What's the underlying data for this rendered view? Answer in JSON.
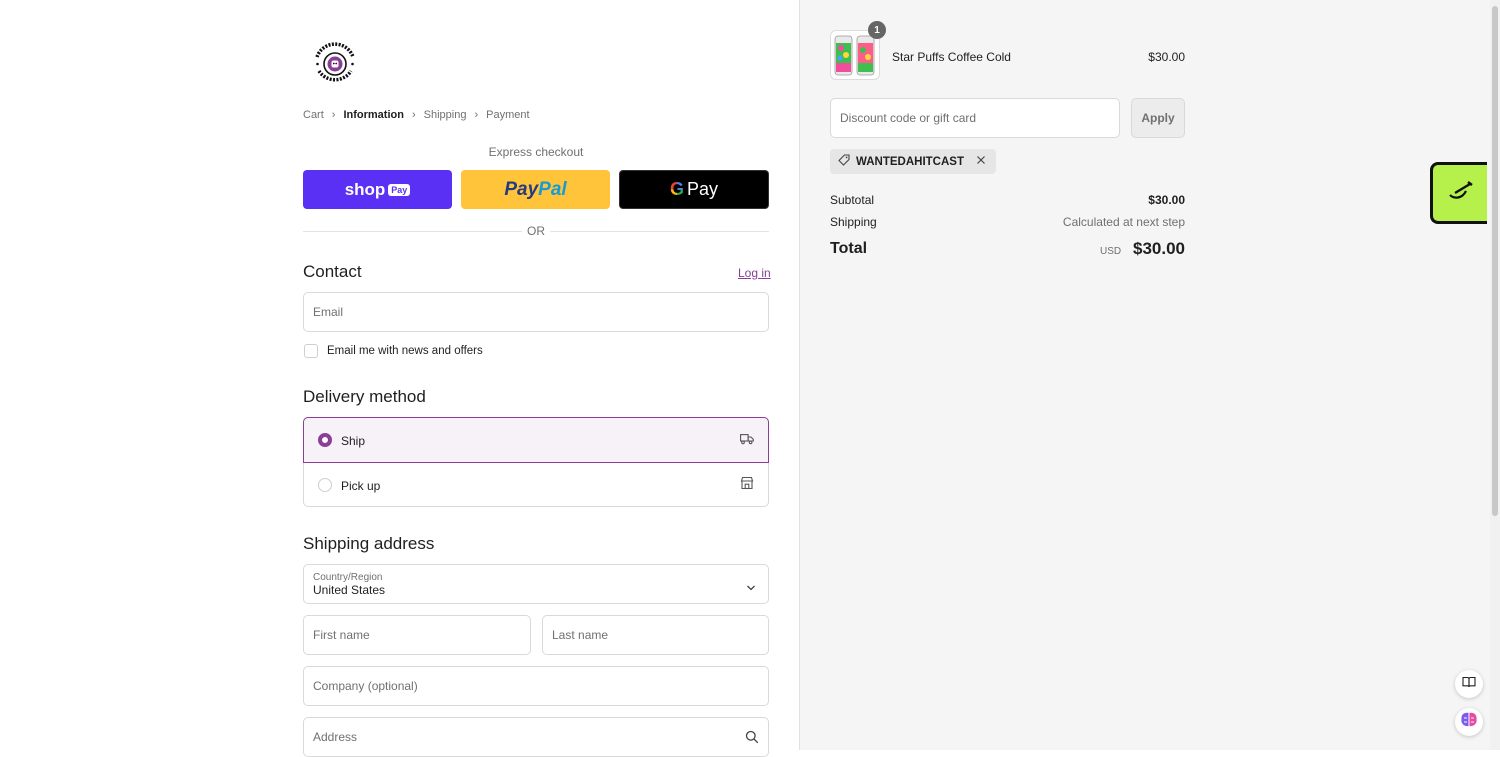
{
  "breadcrumb": {
    "items": [
      {
        "label": "Cart"
      },
      {
        "label": "Information",
        "current": true
      },
      {
        "label": "Shipping"
      },
      {
        "label": "Payment"
      }
    ]
  },
  "express": {
    "heading": "Express checkout",
    "shoppay_label": "shop",
    "shoppay_tag": "Pay",
    "paypal_part1": "Pay",
    "paypal_part2": "Pal",
    "gpay_g": "G",
    "gpay_label": "Pay",
    "divider_text": "OR"
  },
  "contact": {
    "title": "Contact",
    "login_link": "Log in",
    "email_placeholder": "Email",
    "newsletter_label": "Email me with news and offers"
  },
  "delivery": {
    "title": "Delivery method",
    "options": [
      {
        "label": "Ship",
        "selected": true,
        "icon": "truck-icon"
      },
      {
        "label": "Pick up",
        "selected": false,
        "icon": "store-icon"
      }
    ]
  },
  "shipping_address": {
    "title": "Shipping address",
    "country_label": "Country/Region",
    "country_value": "United States",
    "first_name_placeholder": "First name",
    "last_name_placeholder": "Last name",
    "company_placeholder": "Company (optional)",
    "address_placeholder": "Address"
  },
  "order": {
    "item": {
      "name": "Star Puffs Coffee Cold",
      "price": "$30.00",
      "quantity": "1"
    },
    "discount_placeholder": "Discount code or gift card",
    "apply_label": "Apply",
    "applied_code": "WANTEDAHITCAST",
    "subtotal_label": "Subtotal",
    "subtotal_value": "$30.00",
    "shipping_label": "Shipping",
    "shipping_value": "Calculated at next step",
    "total_label": "Total",
    "total_currency": "USD",
    "total_value": "$30.00"
  },
  "colors": {
    "accent": "#8a3e98",
    "shoppay": "#5a31f4",
    "paypal": "#ffc439",
    "widget": "#b6f04b"
  }
}
